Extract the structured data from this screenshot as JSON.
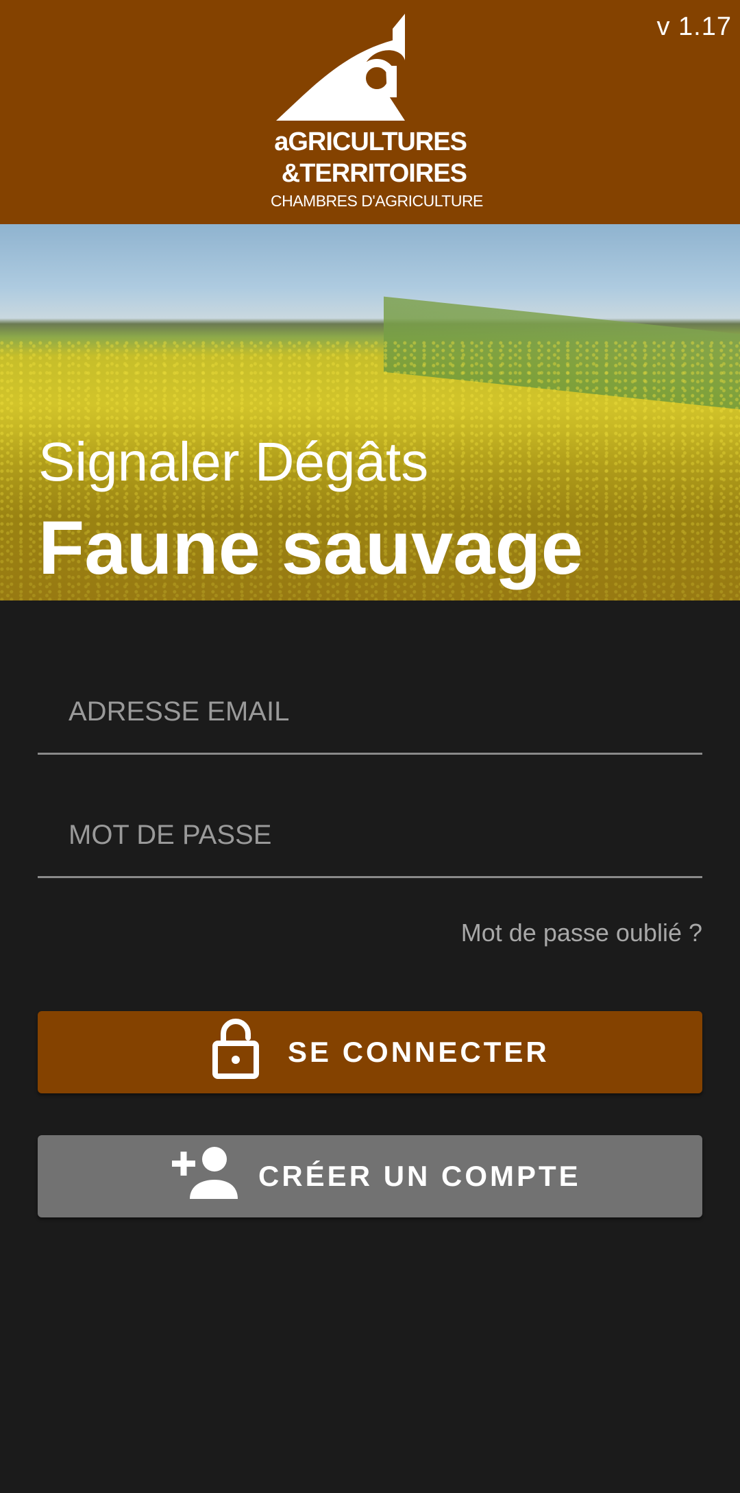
{
  "app": {
    "version": "v 1.17",
    "logo": {
      "name": "agricultures-territoires-logo",
      "line1": "aGRICULTURES",
      "line2": "&TERRITOIRES",
      "line3": "CHAMBRES D'AGRICULTURE"
    }
  },
  "hero": {
    "subtitle": "Signaler Dégâts",
    "title": "Faune sauvage"
  },
  "form": {
    "email": {
      "placeholder": "ADRESSE EMAIL",
      "value": ""
    },
    "password": {
      "placeholder": "MOT DE PASSE",
      "value": ""
    },
    "forgot_label": "Mot de passe oublié ?"
  },
  "buttons": {
    "login": {
      "label": "SE CONNECTER",
      "icon": "lock-open-icon"
    },
    "register": {
      "label": "CRÉER UN COMPTE",
      "icon": "person-add-icon"
    }
  },
  "colors": {
    "brand": "#844200",
    "background": "#1b1b1b",
    "secondary_button": "#727272"
  }
}
